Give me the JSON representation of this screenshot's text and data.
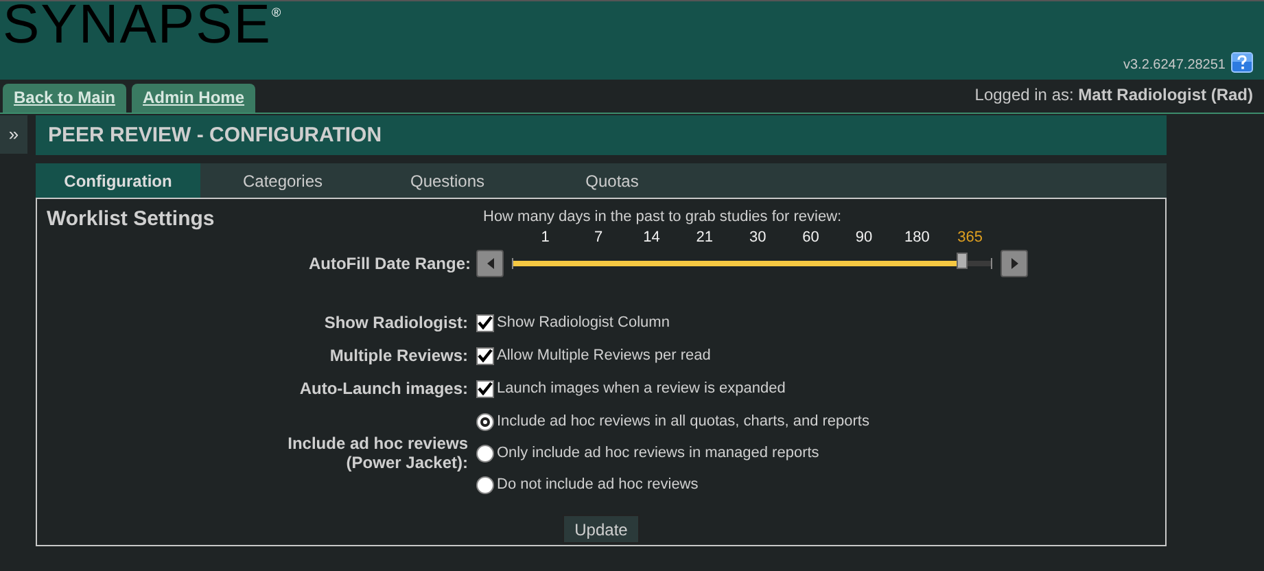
{
  "header": {
    "logo": "SYNAPSE",
    "logo_mark": "®",
    "version": "v3.2.6247.28251"
  },
  "nav_tabs": [
    {
      "label": "Back to Main"
    },
    {
      "label": "Admin Home"
    }
  ],
  "user": {
    "prefix": "Logged in as:",
    "name": "Matt Radiologist (Rad)"
  },
  "sidebar_toggle": "»",
  "page_title": "PEER REVIEW - CONFIGURATION",
  "tabs": [
    {
      "label": "Configuration",
      "selected": true
    },
    {
      "label": "Categories",
      "selected": false
    },
    {
      "label": "Questions",
      "selected": false
    },
    {
      "label": "Quotas",
      "selected": false
    }
  ],
  "section_title": "Worklist Settings",
  "date_range": {
    "prompt": "How many days in the past to grab studies for review:",
    "label": "AutoFill Date Range:",
    "level": 0.94,
    "stops": [
      {
        "label": "1",
        "selected": false
      },
      {
        "label": "7",
        "selected": false
      },
      {
        "label": "14",
        "selected": false
      },
      {
        "label": "21",
        "selected": false
      },
      {
        "label": "30",
        "selected": false
      },
      {
        "label": "60",
        "selected": false
      },
      {
        "label": "90",
        "selected": false
      },
      {
        "label": "180",
        "selected": false
      },
      {
        "label": "365",
        "selected": true
      }
    ]
  },
  "settings": [
    {
      "label": "Show Radiologist:",
      "text": "Show Radiologist Column",
      "checked": true
    },
    {
      "label": "Multiple Reviews:",
      "text": "Allow Multiple Reviews per read",
      "checked": true
    },
    {
      "label": "Auto-Launch images:",
      "text": "Launch images when a review is expanded",
      "checked": true
    }
  ],
  "ad_hoc": {
    "label_lines": [
      "Include ad hoc reviews",
      "(Power Jacket):"
    ],
    "options": [
      {
        "text": "Include ad hoc reviews in all quotas, charts, and reports",
        "selected": true
      },
      {
        "text": "Only include ad hoc reviews in managed reports",
        "selected": false
      },
      {
        "text": "Do not include ad hoc reviews",
        "selected": false
      }
    ]
  },
  "update_button": "Update"
}
